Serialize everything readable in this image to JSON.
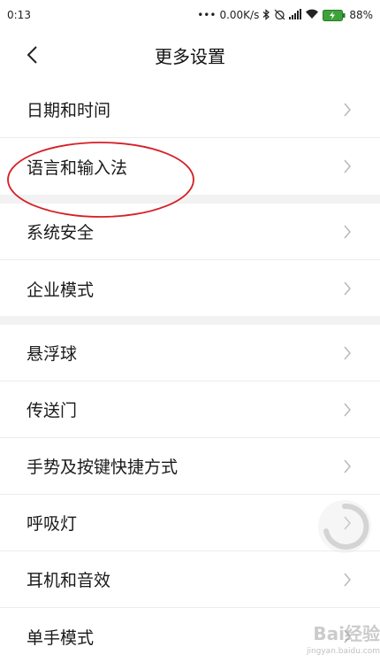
{
  "status_bar": {
    "time": "0:13",
    "network_speed": "0.00K/s",
    "battery_percent": "88%",
    "icons": [
      "dots-icon",
      "bluetooth-icon",
      "alarm-off-icon",
      "signal-icon",
      "wifi-icon",
      "battery-charging-icon"
    ]
  },
  "header": {
    "title": "更多设置",
    "back_icon": "chevron-left-icon"
  },
  "groups": [
    {
      "items": [
        {
          "label": "日期和时间"
        },
        {
          "label": "语言和输入法"
        }
      ]
    },
    {
      "items": [
        {
          "label": "系统安全"
        },
        {
          "label": "企业模式"
        }
      ]
    },
    {
      "items": [
        {
          "label": "悬浮球"
        },
        {
          "label": "传送门"
        },
        {
          "label": "手势及按键快捷方式"
        },
        {
          "label": "呼吸灯"
        },
        {
          "label": "耳机和音效"
        },
        {
          "label": "单手模式"
        }
      ]
    }
  ],
  "annotation": {
    "color": "#d61f26",
    "target": "语言和输入法"
  },
  "watermark": {
    "logo": "Bai经验",
    "url": "jingyan.baidu.com"
  }
}
